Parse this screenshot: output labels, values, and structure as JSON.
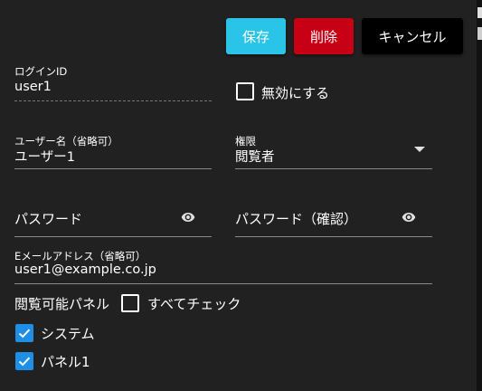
{
  "toolbar": {
    "save_label": "保存",
    "delete_label": "削除",
    "cancel_label": "キャンセル"
  },
  "form": {
    "login_id": {
      "label": "ログインID",
      "value": "user1"
    },
    "disable": {
      "label": "無効にする",
      "checked": false
    },
    "username": {
      "label": "ユーザー名（省略可）",
      "value": "ユーザー1"
    },
    "permission": {
      "label": "権限",
      "value": "閲覧者"
    },
    "password": {
      "placeholder": "パスワード"
    },
    "password_confirm": {
      "placeholder": "パスワード（確認）"
    },
    "email": {
      "label": "Eメールアドレス（省略可）",
      "value": "user1@example.co.jp"
    },
    "panels": {
      "label": "閲覧可能パネル",
      "check_all": {
        "label": "すべてチェック",
        "checked": false
      },
      "items": [
        {
          "label": "システム",
          "checked": true
        },
        {
          "label": "パネル1",
          "checked": true
        }
      ]
    }
  },
  "colors": {
    "save": "#29c4e8",
    "delete": "#c70016",
    "cancel": "#000000",
    "checkbox": "#1e8ee6",
    "background": "#212121"
  }
}
